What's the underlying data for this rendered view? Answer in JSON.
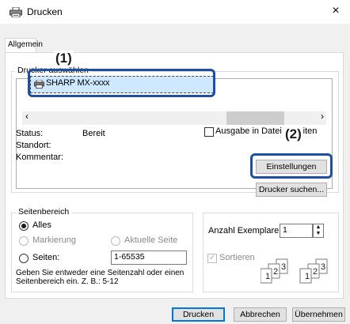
{
  "window": {
    "title": "Drucken",
    "close_symbol": "×"
  },
  "tabs": [
    {
      "label": "Allgemein"
    }
  ],
  "printer_section": {
    "group_label": "Drucker auswählen",
    "printers": [
      {
        "name": "SHARP MX-xxxx"
      }
    ]
  },
  "callouts": {
    "one": "(1)",
    "two": "(2)"
  },
  "status": {
    "status_label": "Status:",
    "status_value": "Bereit",
    "location_label": "Standort:",
    "comment_label": "Kommentar:"
  },
  "output_to_file": {
    "label": "Ausgabe in Datei umleiten",
    "checked": false
  },
  "buttons": {
    "settings": "Einstellungen",
    "find_printer": "Drucker suchen...",
    "print": "Drucken",
    "cancel": "Abbrechen",
    "apply": "Übernehmen"
  },
  "page_range": {
    "group_label": "Seitenbereich",
    "all_label": "Alles",
    "selection_label": "Markierung",
    "current_page_label": "Aktuelle Seite",
    "pages_label": "Seiten:",
    "pages_value": "1-65535",
    "hint": "Geben Sie entweder eine Seitenzahl oder einen Seitenbereich ein. Z. B.: 5-12",
    "selected": "all"
  },
  "copies": {
    "label": "Anzahl Exemplare:",
    "value": "1",
    "collate_label": "Sortieren",
    "collate_checked": true
  },
  "colors": {
    "highlight_border": "#1f4fa3",
    "selection_fill": "#cde8ff",
    "primary_button_border": "#0078d7"
  }
}
